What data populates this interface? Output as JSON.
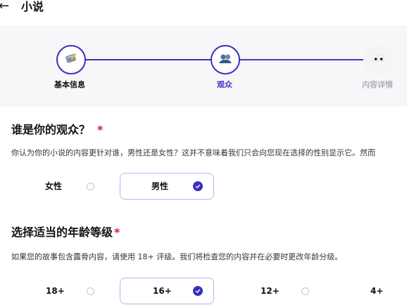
{
  "header": {
    "back_icon": "arrow-left-icon",
    "title": "小说"
  },
  "stepper": {
    "steps": [
      {
        "label": "基本信息",
        "state": "done",
        "icon": "notebook-pen-icon"
      },
      {
        "label": "观众",
        "state": "active",
        "icon": "audience-icon"
      },
      {
        "label": "内容详情",
        "state": "todo",
        "icon": "eyes-icon"
      }
    ],
    "accent": "#3b2fbf"
  },
  "audience": {
    "title": "谁是你的观众？",
    "required_mark": "*",
    "description": "你认为你的小说的内容更针对谁，男性还是女性？这并不意味着我们只会向您现在选择的性别显示它。然而",
    "options": [
      {
        "label": "女性",
        "selected": false
      },
      {
        "label": "男性",
        "selected": true
      }
    ]
  },
  "age": {
    "title": "选择适当的年龄等级",
    "required_mark": "*",
    "description": "如果您的故事包含露骨内容，请使用 18+ 评级。我们将检查您的内容并在必要时更改年龄分级。",
    "options": [
      {
        "label": "18+",
        "selected": false
      },
      {
        "label": "16+",
        "selected": true
      },
      {
        "label": "12+",
        "selected": false
      },
      {
        "label": "4+",
        "selected": false
      }
    ]
  }
}
